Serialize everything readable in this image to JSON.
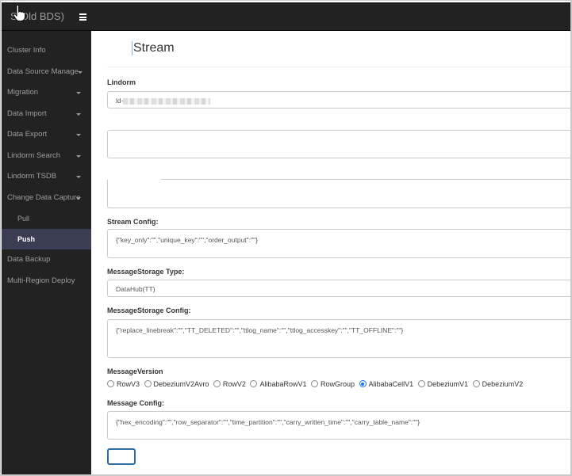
{
  "app": {
    "brand": "BDS(Old BDS)",
    "brand_visible": "S(Old BDS)",
    "menu_icon": "hamburger-icon"
  },
  "sidebar": {
    "items": [
      {
        "label": "Cluster Info",
        "has_caret": false
      },
      {
        "label": "Data Source Manage",
        "has_caret": true
      },
      {
        "label": "Migration",
        "has_caret": true
      },
      {
        "label": "Data Import",
        "has_caret": true
      },
      {
        "label": "Data Export",
        "has_caret": true
      },
      {
        "label": "Lindorm Search",
        "has_caret": true
      },
      {
        "label": "Lindorm TSDB",
        "has_caret": true
      },
      {
        "label": "Change Data Capture",
        "has_caret": true
      },
      {
        "label": "Pull",
        "sub": true
      },
      {
        "label": "Push",
        "sub": true,
        "active": true
      },
      {
        "label": "Data Backup",
        "has_caret": false
      },
      {
        "label": "Multi-Region Deploy",
        "has_caret": false
      }
    ]
  },
  "page": {
    "title": "Stream"
  },
  "form": {
    "lindorm": {
      "label": "Lindorm",
      "value_prefix": "ld-"
    },
    "stream_config": {
      "label": "Stream Config:",
      "value": "{\"key_only\":\"\",\"unique_key\":\"\",\"order_output\":\"\"}"
    },
    "message_storage_type": {
      "label": "MessageStorage Type:",
      "value": "DataHub(TT)"
    },
    "message_storage_config": {
      "label": "MessageStorage Config:",
      "value": "{\"replace_linebreak\":\"\",\"TT_DELETED\":\"\",\"ttlog_name\":\"\",\"ttlog_accesskey\":\"\",\"TT_OFFLINE\":\"\"}"
    },
    "message_version": {
      "label": "MessageVersion",
      "options": [
        "RowV3",
        "DebeziumV2Avro",
        "RowV2",
        "AlibabaRowV1",
        "RowGroup",
        "AlibabaCellV1",
        "DebeziumV1",
        "DebeziumV2"
      ],
      "selected": "AlibabaCellV1"
    },
    "message_config": {
      "label": "Message Config:",
      "value": "{\"hex_encoding\":\"\",\"row_separator\":\"\",\"time_partition\":\"\",\"carry_written_time\":\"\",\"carry_table_name\":\"\"}"
    },
    "submit_label": ""
  }
}
